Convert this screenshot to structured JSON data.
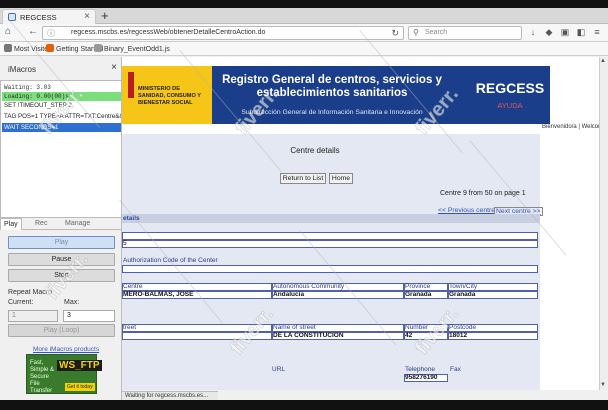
{
  "browser": {
    "tab_title": "REGCESS",
    "tab_close": "×",
    "new_tab": "+",
    "url": "regcess.mscbs.es/regcessWeb/obtenerDetalleCentroAction.do",
    "search_placeholder": "Search",
    "bookmarks": [
      "Most Visited",
      "Getting Started",
      "Binary_EventOdd1.js"
    ]
  },
  "imacros": {
    "title": "iMacros",
    "close": "×",
    "macro_lines": [
      "Waiting: 3.03",
      "Loading: 0.00(00)s",
      "SET !TIMEOUT_STEP 2",
      "TAG POS=1 TYPE=A ATTR=TXT:Centre&&TITLE:...",
      "WAIT SECONDS=1"
    ],
    "tabs": [
      "Play",
      "Rec",
      "Manage"
    ],
    "play_button": "Play",
    "pause_button": "Pause",
    "stop_button": "Stop",
    "repeat_label": "Repeat Macro",
    "current_label": "Current:",
    "max_label": "Max:",
    "current_value": "1",
    "max_value": "3",
    "play_loop_button": "Play (Loop)",
    "more_products": "More iMacros products",
    "ad_text": "Fast, Simple & Secure File Transfer",
    "ad_logo": "WS_FTP",
    "ad_go": "Get it today"
  },
  "site": {
    "ministry": "MINISTERIO DE SANIDAD, CONSUMO Y BIENESTAR SOCIAL",
    "title": "Registro General de centros, servicios y establecimientos sanitarios",
    "subtitle": "Subdirección General de Información Sanitaria e Innovación",
    "brand": "REGCESS",
    "help": "AYUDA",
    "welcome": "Bienvenido/a | Welcome",
    "page_title": "Centre details",
    "return_button": "Return to List",
    "home_button": "Home",
    "pager": "Centre 9 from 50 on page 1",
    "prev_link": "<< Previous centre",
    "next_link": "Next centre >>",
    "section": "etails",
    "row2_value": "5",
    "auth_label": "Authorization Code of the Center",
    "labels": {
      "centre": "Centre",
      "community": "Autonomous Community",
      "province": "Province",
      "town": "Town/City",
      "street": "treet",
      "street_name": "Name of street",
      "number": "Number",
      "postcode": "Postcode",
      "url": "URL",
      "telephone": "Telephone",
      "fax": "Fax"
    },
    "values": {
      "centre": "MERO-BALMAS, JOSE",
      "community": "Andalucía",
      "province": "Granada",
      "town": "Granada",
      "street_name": "DE LA CONSTITUCION",
      "number": "42",
      "postcode": "18012",
      "telephone": "958276190"
    }
  },
  "status_text": "Waiting for regcess.mscbs.es...",
  "watermark": "fiverr."
}
